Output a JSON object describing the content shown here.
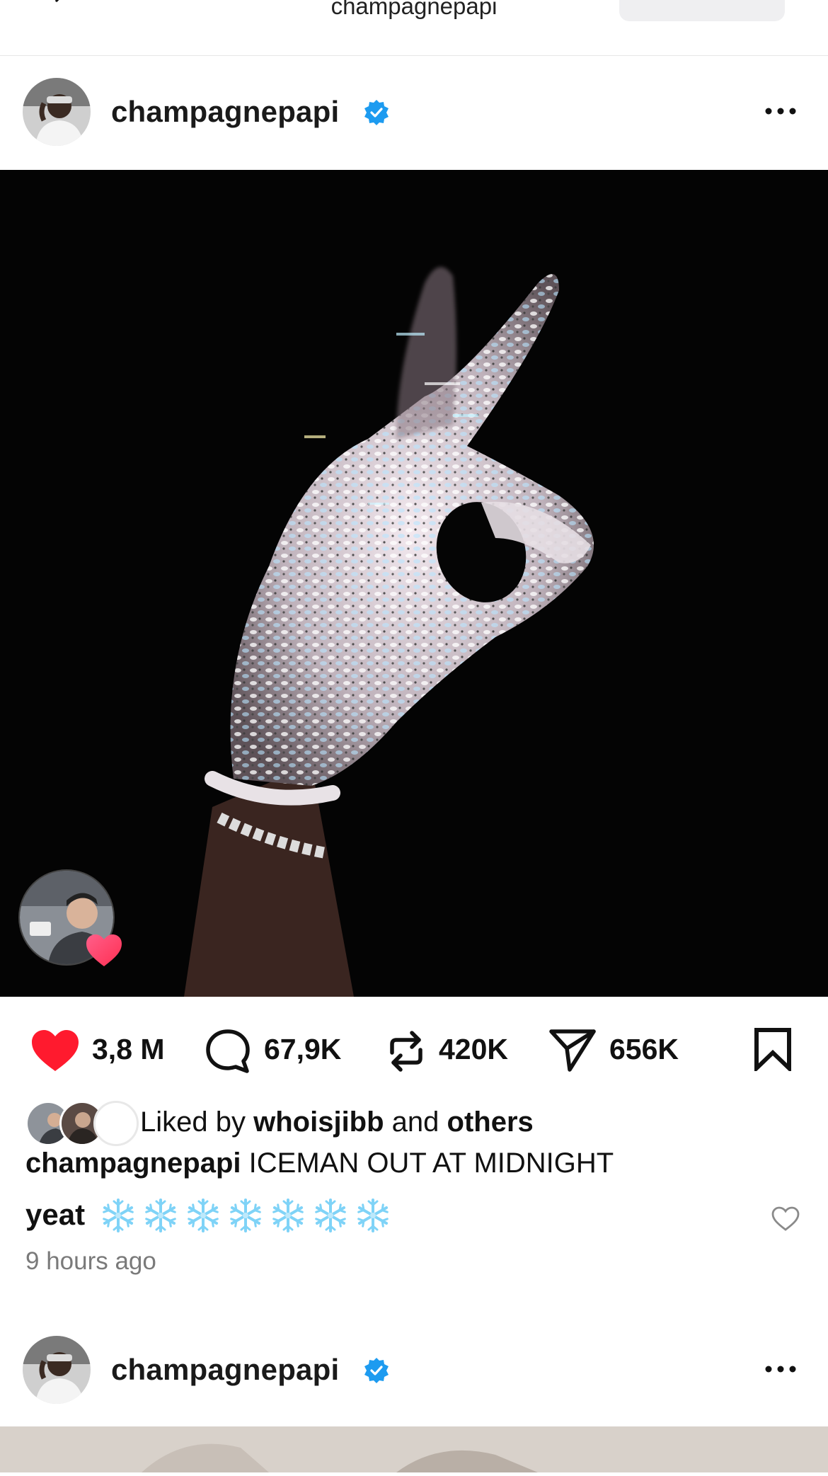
{
  "topbar": {
    "title": "champagnepapi",
    "back_icon": "chevron-left-icon"
  },
  "post": {
    "username": "champagnepapi",
    "verified": true,
    "accent_color": "#1d9bf0",
    "actions": {
      "likes": "3,8 M",
      "comments": "67,9K",
      "reposts": "420K",
      "shares": "656K",
      "liked_state": true,
      "like_color": "#ff1a2e"
    },
    "liked_by": {
      "prefix": "Liked by",
      "user": "whoisjibb",
      "connector": "and",
      "others": "others"
    },
    "caption": {
      "username": "champagnepapi",
      "text": "ICEMAN OUT AT MIDNIGHT"
    },
    "top_comment": {
      "username": "yeat",
      "emoji_count": 7,
      "emoji": "snowflake-icon"
    },
    "timestamp": "9 hours ago"
  },
  "next_post": {
    "username": "champagnepapi",
    "verified": true
  }
}
